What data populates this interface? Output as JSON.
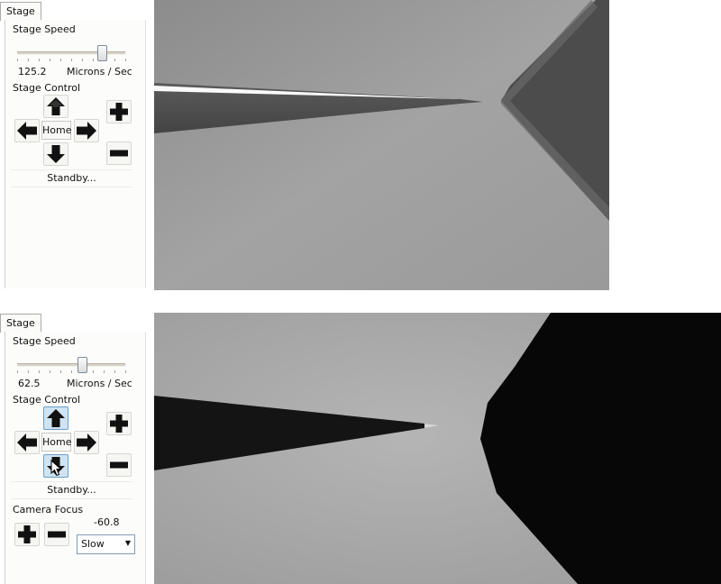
{
  "top_panel": {
    "tab_label": "Stage",
    "stage_speed_label": "Stage Speed",
    "speed_value": "125.2",
    "speed_units": "Microns / Sec",
    "speed_slider_fraction": 0.78,
    "stage_control_label": "Stage Control",
    "home_label": "Home",
    "status_text": "Standby..."
  },
  "bottom_panel": {
    "tab_label": "Stage",
    "stage_speed_label": "Stage Speed",
    "speed_value": "62.5",
    "speed_units": "Microns / Sec",
    "speed_slider_fraction": 0.6,
    "stage_control_label": "Stage Control",
    "home_label": "Home",
    "status_text": "Standby...",
    "camera_focus_label": "Camera Focus",
    "focus_value": "-60.8",
    "focus_speed_selected": "Slow"
  },
  "icons": {
    "up": "arrow-up-icon",
    "down": "arrow-down-icon",
    "left": "arrow-left-icon",
    "right": "arrow-right-icon",
    "plus": "plus-icon",
    "minus": "minus-icon",
    "cursor": "mouse-cursor-icon"
  },
  "colors": {
    "active_button": "#cfe3f2",
    "active_border": "#6a9ec6"
  }
}
